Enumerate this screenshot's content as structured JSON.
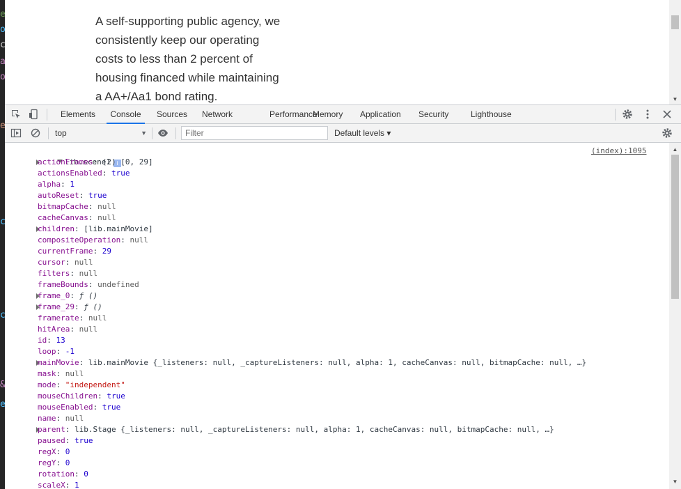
{
  "page": {
    "lines": [
      "A self-supporting public agency, we",
      "consistently keep our operating",
      "costs to less than 2 percent of",
      "housing financed while maintaining",
      "a AA+/Aa1 bond rating."
    ]
  },
  "devtools": {
    "tabs": [
      "Elements",
      "Console",
      "Sources",
      "Network",
      "Performance",
      "Memory",
      "Application",
      "Security",
      "Lighthouse"
    ],
    "active_tab": "Console",
    "icons": {
      "inspect": "inspect-element-icon",
      "device": "device-toolbar-icon",
      "settings": "gear-icon",
      "more": "vertical-dots-icon",
      "close": "close-icon"
    }
  },
  "console_toolbar": {
    "context": "top",
    "filter_placeholder": "Filter",
    "levels": "Default levels ▾"
  },
  "console": {
    "source": "(index):1095",
    "root_label": "lib.scene1",
    "info_badge": "i",
    "rows": [
      {
        "key": "actionFrames",
        "value": "(2) [0, 29]",
        "type": "plain",
        "expandable": true
      },
      {
        "key": "actionsEnabled",
        "value": "true",
        "type": "num",
        "expandable": false
      },
      {
        "key": "alpha",
        "value": "1",
        "type": "num",
        "expandable": false
      },
      {
        "key": "autoReset",
        "value": "true",
        "type": "num",
        "expandable": false
      },
      {
        "key": "bitmapCache",
        "value": "null",
        "type": "null",
        "expandable": false
      },
      {
        "key": "cacheCanvas",
        "value": "null",
        "type": "null",
        "expandable": false
      },
      {
        "key": "children",
        "value": "[lib.mainMovie]",
        "type": "plain",
        "expandable": true
      },
      {
        "key": "compositeOperation",
        "value": "null",
        "type": "null",
        "expandable": false
      },
      {
        "key": "currentFrame",
        "value": "29",
        "type": "num",
        "expandable": false
      },
      {
        "key": "cursor",
        "value": "null",
        "type": "null",
        "expandable": false
      },
      {
        "key": "filters",
        "value": "null",
        "type": "null",
        "expandable": false
      },
      {
        "key": "frameBounds",
        "value": "undefined",
        "type": "null",
        "expandable": false
      },
      {
        "key": "frame_0",
        "value": "ƒ ()",
        "type": "fn",
        "expandable": true
      },
      {
        "key": "frame_29",
        "value": "ƒ ()",
        "type": "fn",
        "expandable": true
      },
      {
        "key": "framerate",
        "value": "null",
        "type": "null",
        "expandable": false
      },
      {
        "key": "hitArea",
        "value": "null",
        "type": "null",
        "expandable": false
      },
      {
        "key": "id",
        "value": "13",
        "type": "num",
        "expandable": false
      },
      {
        "key": "loop",
        "value": "-1",
        "type": "num",
        "expandable": false
      },
      {
        "key": "mainMovie",
        "value": "lib.mainMovie {_listeners: null, _captureListeners: null, alpha: 1, cacheCanvas: null, bitmapCache: null, …}",
        "type": "plain",
        "expandable": true
      },
      {
        "key": "mask",
        "value": "null",
        "type": "null",
        "expandable": false
      },
      {
        "key": "mode",
        "value": "\"independent\"",
        "type": "str",
        "expandable": false
      },
      {
        "key": "mouseChildren",
        "value": "true",
        "type": "num",
        "expandable": false
      },
      {
        "key": "mouseEnabled",
        "value": "true",
        "type": "num",
        "expandable": false
      },
      {
        "key": "name",
        "value": "null",
        "type": "null",
        "expandable": false
      },
      {
        "key": "parent",
        "value": "lib.Stage {_listeners: null, _captureListeners: null, alpha: 1, cacheCanvas: null, bitmapCache: null, …}",
        "type": "plain",
        "expandable": true
      },
      {
        "key": "paused",
        "value": "true",
        "type": "num",
        "expandable": false
      },
      {
        "key": "regX",
        "value": "0",
        "type": "num",
        "expandable": false
      },
      {
        "key": "regY",
        "value": "0",
        "type": "num",
        "expandable": false
      },
      {
        "key": "rotation",
        "value": "0",
        "type": "num",
        "expandable": false
      },
      {
        "key": "scaleX",
        "value": "1",
        "type": "num",
        "expandable": false
      }
    ]
  },
  "colors": {
    "accent": "#1a73e8",
    "key": "#881391",
    "number": "#1c00cf",
    "string": "#c41a16",
    "null": "#5e5e5e"
  }
}
